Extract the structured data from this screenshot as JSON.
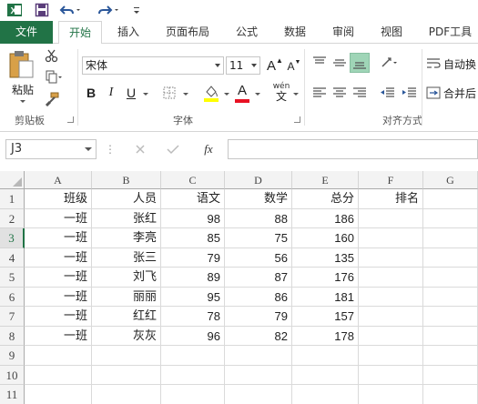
{
  "tabs": [
    {
      "label": "文件",
      "name": "tab-file"
    },
    {
      "label": "开始",
      "name": "tab-home"
    },
    {
      "label": "插入",
      "name": "tab-insert"
    },
    {
      "label": "页面布局",
      "name": "tab-page-layout"
    },
    {
      "label": "公式",
      "name": "tab-formulas"
    },
    {
      "label": "数据",
      "name": "tab-data"
    },
    {
      "label": "审阅",
      "name": "tab-review"
    },
    {
      "label": "视图",
      "name": "tab-view"
    },
    {
      "label": "PDF工具",
      "name": "tab-pdf-tools"
    }
  ],
  "ribbon": {
    "paste_label": "粘贴",
    "clipboard_label": "剪贴板",
    "font_group_label": "字体",
    "alignment_group_label": "对齐方式",
    "font_name": "宋体",
    "font_size": "11",
    "bold": "B",
    "italic": "I",
    "underline": "U",
    "wrap_text": "自动换",
    "merge_center": "合并后",
    "phonetic_top": "wén",
    "phonetic_bottom": "文",
    "grow_font": "A",
    "shrink_font": "A",
    "font_color_letter": "A",
    "fill_color": "#ffff00",
    "font_color": "#e81123",
    "accent": "#217346"
  },
  "formula_bar": {
    "name_box": "J3",
    "fx": "fx",
    "value": ""
  },
  "columns": [
    "A",
    "B",
    "C",
    "D",
    "E",
    "F",
    "G"
  ],
  "rows": [
    "1",
    "2",
    "3",
    "4",
    "5",
    "6",
    "7",
    "8",
    "9",
    "10",
    "11"
  ],
  "selected_row": "3",
  "sheet": [
    [
      "班级",
      "人员",
      "语文",
      "数学",
      "总分",
      "排名",
      ""
    ],
    [
      "一班",
      "张红",
      "98",
      "88",
      "186",
      "",
      ""
    ],
    [
      "一班",
      "李亮",
      "85",
      "75",
      "160",
      "",
      ""
    ],
    [
      "一班",
      "张三",
      "79",
      "56",
      "135",
      "",
      ""
    ],
    [
      "一班",
      "刘飞",
      "89",
      "87",
      "176",
      "",
      ""
    ],
    [
      "一班",
      "丽丽",
      "95",
      "86",
      "181",
      "",
      ""
    ],
    [
      "一班",
      "红红",
      "78",
      "79",
      "157",
      "",
      ""
    ],
    [
      "一班",
      "灰灰",
      "96",
      "82",
      "178",
      "",
      ""
    ],
    [
      "",
      "",
      "",
      "",
      "",
      "",
      ""
    ],
    [
      "",
      "",
      "",
      "",
      "",
      "",
      ""
    ],
    [
      "",
      "",
      "",
      "",
      "",
      "",
      ""
    ]
  ]
}
